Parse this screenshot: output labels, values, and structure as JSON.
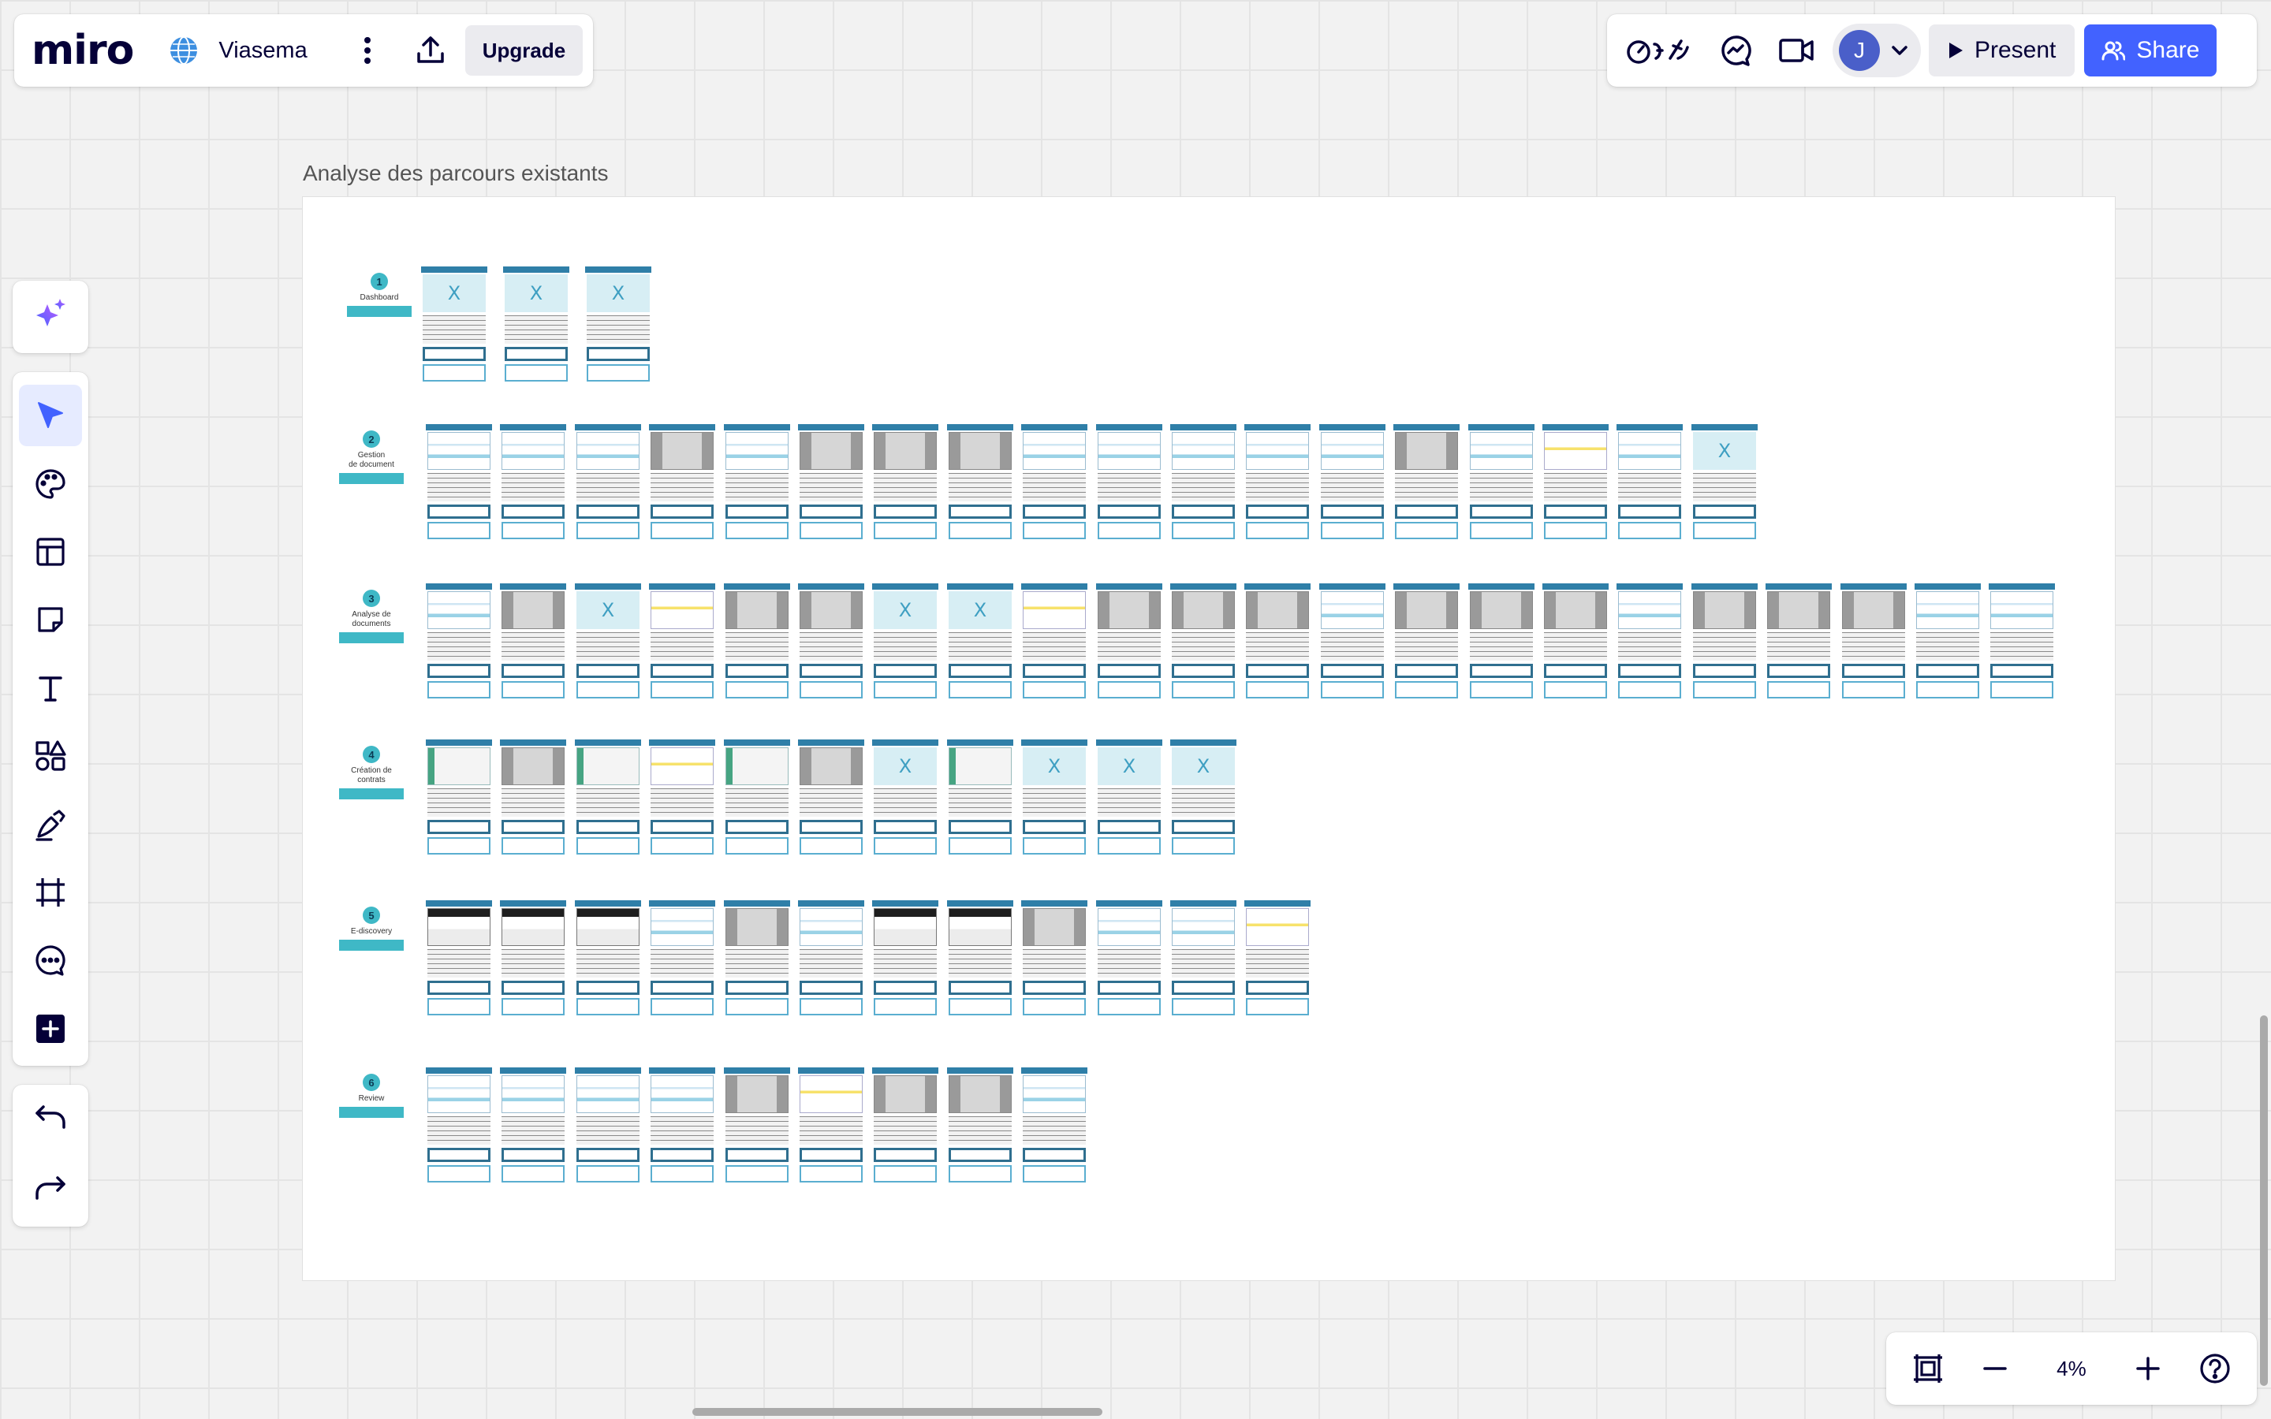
{
  "app": {
    "logo": "miro",
    "board_name": "Viasema",
    "upgrade_label": "Upgrade",
    "present_label": "Present",
    "share_label": "Share",
    "avatar_initial": "J",
    "accent": "#4262ff"
  },
  "toolbar": {
    "tools": [
      {
        "name": "select-tool",
        "icon": "arrow-cursor-icon",
        "active": true
      },
      {
        "name": "ai-templates-tool",
        "icon": "palette-icon"
      },
      {
        "name": "templates-tool",
        "icon": "layout-icon"
      },
      {
        "name": "sticky-note-tool",
        "icon": "sticky-note-icon"
      },
      {
        "name": "text-tool",
        "icon": "text-icon"
      },
      {
        "name": "shapes-tool",
        "icon": "shapes-icon"
      },
      {
        "name": "pen-tool",
        "icon": "pen-icon"
      },
      {
        "name": "frame-tool",
        "icon": "frame-icon"
      },
      {
        "name": "comment-tool",
        "icon": "comment-icon"
      },
      {
        "name": "more-apps-tool",
        "icon": "plus-square-icon"
      }
    ]
  },
  "frame": {
    "title": "Analyse des parcours existants",
    "rows": [
      {
        "num": "1",
        "label": "Dashboard",
        "cards": [
          "x",
          "x",
          "x"
        ]
      },
      {
        "num": "2",
        "label": "Gestion\nde document",
        "cards": [
          "s1",
          "s1",
          "s1",
          "s2",
          "s1",
          "s2",
          "s2",
          "s2",
          "s1",
          "s1",
          "s1",
          "s1",
          "s1",
          "s2",
          "s1",
          "s4",
          "s1",
          "x"
        ]
      },
      {
        "num": "3",
        "label": "Analyse de\ndocuments",
        "cards": [
          "s1",
          "s2",
          "x",
          "s4",
          "s2",
          "s2",
          "x",
          "x",
          "s4",
          "s2",
          "s2",
          "s2",
          "s1",
          "s2",
          "s2",
          "s2",
          "s1",
          "s2",
          "s2",
          "s2",
          "s1",
          "s1"
        ]
      },
      {
        "num": "4",
        "label": "Création de\ncontrats",
        "cards": [
          "s5",
          "s2",
          "s5",
          "s4",
          "s5",
          "s2",
          "x",
          "s5",
          "x",
          "x",
          "x"
        ]
      },
      {
        "num": "5",
        "label": "E-discovery",
        "cards": [
          "s3",
          "s3",
          "s3",
          "s1",
          "s2",
          "s1",
          "s3",
          "s3",
          "s2",
          "s1",
          "s1",
          "s4"
        ]
      },
      {
        "num": "6",
        "label": "Review",
        "cards": [
          "s1",
          "s1",
          "s1",
          "s1",
          "s2",
          "s4",
          "s2",
          "s2",
          "s1"
        ]
      }
    ]
  },
  "zoom": {
    "level": "4%"
  }
}
